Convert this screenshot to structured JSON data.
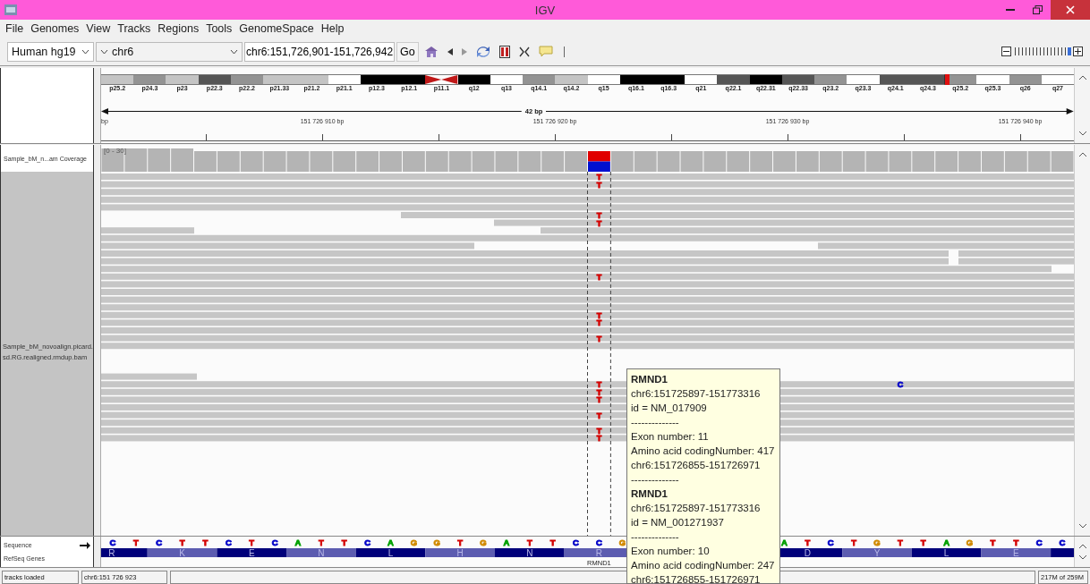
{
  "window": {
    "title": "IGV"
  },
  "menu": [
    "File",
    "Genomes",
    "View",
    "Tracks",
    "Regions",
    "Tools",
    "GenomeSpace",
    "Help"
  ],
  "toolbar": {
    "genome": "Human hg19",
    "chromosome": "chr6",
    "locus": "chr6:151,726,901-151,726,942",
    "go": "Go",
    "zoom": {
      "level": 1
    }
  },
  "ideogram": {
    "bands": [
      {
        "label": "p25.2",
        "kind": "gpos25",
        "current": false
      },
      {
        "label": "p24.3",
        "kind": "gpos50",
        "current": false
      },
      {
        "label": "p23",
        "kind": "gpos25",
        "current": false
      },
      {
        "label": "p22.3",
        "kind": "gpos75",
        "current": false
      },
      {
        "label": "p22.2",
        "kind": "gpos50",
        "current": false
      },
      {
        "label": "p21.33",
        "kind": "gpos25",
        "current": false
      },
      {
        "label": "p21.2",
        "kind": "gpos25",
        "current": false
      },
      {
        "label": "p21.1",
        "kind": "gneg",
        "current": false
      },
      {
        "label": "p12.3",
        "kind": "gpos100",
        "current": false
      },
      {
        "label": "p12.1",
        "kind": "gpos100",
        "current": false
      },
      {
        "label": "p11.1",
        "kind": "acen",
        "current": false
      },
      {
        "label": "q12",
        "kind": "gpos100",
        "current": false
      },
      {
        "label": "q13",
        "kind": "gneg",
        "current": false
      },
      {
        "label": "q14.1",
        "kind": "gpos50",
        "current": false
      },
      {
        "label": "q14.2",
        "kind": "gpos25",
        "current": false
      },
      {
        "label": "q15",
        "kind": "gneg",
        "current": false
      },
      {
        "label": "q16.1",
        "kind": "gpos100",
        "current": false
      },
      {
        "label": "q16.3",
        "kind": "gpos100",
        "current": false
      },
      {
        "label": "q21",
        "kind": "gneg",
        "current": false
      },
      {
        "label": "q22.1",
        "kind": "gpos75",
        "current": false
      },
      {
        "label": "q22.31",
        "kind": "gpos100",
        "current": false
      },
      {
        "label": "q22.33",
        "kind": "gpos75",
        "current": false
      },
      {
        "label": "q23.2",
        "kind": "gpos50",
        "current": false
      },
      {
        "label": "q23.3",
        "kind": "gneg",
        "current": false
      },
      {
        "label": "q24.1",
        "kind": "gpos75",
        "current": false
      },
      {
        "label": "q24.3",
        "kind": "gpos75",
        "current": false
      },
      {
        "label": "q25.2",
        "kind": "gpos50",
        "current": true
      },
      {
        "label": "q25.3",
        "kind": "gneg",
        "current": false
      },
      {
        "label": "q26",
        "kind": "gpos50",
        "current": false
      },
      {
        "label": "q27",
        "kind": "gneg",
        "current": false
      }
    ]
  },
  "ruler": {
    "span": "42 bp",
    "labels": [
      "bp",
      "151 726 910 bp",
      "151 726 920 bp",
      "151 726 930 bp",
      "151 726 940 bp"
    ]
  },
  "tracks": {
    "coverage_name": "Sample_bM_n...am Coverage",
    "coverage_range": "[0 - 30]",
    "alignment_name": "Sample_bM_novoalign.picard.sd.RG.realigned.rmdup.bam",
    "sequence_name": "Sequence",
    "genes_name": "RefSeq Genes"
  },
  "alignments": {
    "rows": [
      {
        "kind": "full",
        "mismatches": [
          {
            "base": "T",
            "color": "#d40000",
            "kind": "center"
          }
        ]
      },
      {
        "kind": "full",
        "mismatches": [
          {
            "base": "T",
            "color": "#d40000",
            "kind": "center"
          }
        ]
      },
      {
        "kind": "full"
      },
      {
        "kind": "full"
      },
      {
        "kind": "full"
      },
      {
        "kind": "partial",
        "mismatches": [
          {
            "base": "T",
            "color": "#d40000",
            "kind": "center"
          }
        ]
      },
      {
        "kind": "partial",
        "mismatches": [
          {
            "base": "T",
            "color": "#d40000",
            "kind": "center"
          }
        ]
      },
      {
        "kind": "partial"
      },
      {
        "kind": "full"
      },
      {
        "kind": "partial"
      },
      {
        "kind": "partial"
      },
      {
        "kind": "partial"
      },
      {
        "kind": "partial"
      },
      {
        "kind": "full",
        "mismatches": [
          {
            "base": "T",
            "color": "#d40000",
            "kind": "center"
          }
        ]
      },
      {
        "kind": "full"
      },
      {
        "kind": "full"
      },
      {
        "kind": "full"
      },
      {
        "kind": "full"
      },
      {
        "kind": "full",
        "mismatches": [
          {
            "base": "T",
            "color": "#d40000",
            "kind": "center"
          }
        ]
      },
      {
        "kind": "full",
        "mismatches": [
          {
            "base": "T",
            "color": "#d40000",
            "kind": "center"
          }
        ]
      },
      {
        "kind": "full"
      },
      {
        "kind": "full",
        "mismatches": [
          {
            "base": "T",
            "color": "#d40000",
            "kind": "center"
          }
        ]
      },
      {
        "kind": "full"
      },
      {
        "kind": "partial"
      },
      {
        "kind": "full",
        "mismatches": [
          {
            "base": "T",
            "color": "#d40000",
            "kind": "center"
          },
          {
            "base": "C",
            "color": "#0000c8",
            "kind": "right"
          }
        ]
      },
      {
        "kind": "full",
        "mismatches": [
          {
            "base": "T",
            "color": "#d40000",
            "kind": "center"
          }
        ]
      },
      {
        "kind": "full",
        "mismatches": [
          {
            "base": "T",
            "color": "#d40000",
            "kind": "center"
          }
        ]
      },
      {
        "kind": "full"
      },
      {
        "kind": "full",
        "mismatches": [
          {
            "base": "T",
            "color": "#d40000",
            "kind": "center"
          }
        ]
      },
      {
        "kind": "full"
      },
      {
        "kind": "full",
        "mismatches": [
          {
            "base": "T",
            "color": "#d40000",
            "kind": "center"
          }
        ]
      },
      {
        "kind": "full",
        "mismatches": [
          {
            "base": "T",
            "color": "#d40000",
            "kind": "center"
          }
        ]
      }
    ]
  },
  "sequence": {
    "left": [
      {
        "base": "C",
        "color": "#0000c8"
      },
      {
        "base": "T",
        "color": "#d40000"
      },
      {
        "base": "C",
        "color": "#0000c8"
      },
      {
        "base": "T",
        "color": "#d40000"
      },
      {
        "base": "T",
        "color": "#d40000"
      },
      {
        "base": "C",
        "color": "#0000c8"
      },
      {
        "base": "T",
        "color": "#d40000"
      },
      {
        "base": "C",
        "color": "#0000c8"
      },
      {
        "base": "A",
        "color": "#00a000"
      },
      {
        "base": "T",
        "color": "#d40000"
      },
      {
        "base": "T",
        "color": "#d40000"
      },
      {
        "base": "C",
        "color": "#0000c8"
      },
      {
        "base": "A",
        "color": "#00a000"
      },
      {
        "base": "G",
        "color": "#d18a00"
      },
      {
        "base": "G",
        "color": "#d18a00"
      },
      {
        "base": "T",
        "color": "#d40000"
      },
      {
        "base": "G",
        "color": "#d18a00"
      },
      {
        "base": "A",
        "color": "#00a000"
      },
      {
        "base": "T",
        "color": "#d40000"
      },
      {
        "base": "T",
        "color": "#d40000"
      },
      {
        "base": "C",
        "color": "#0000c8"
      },
      {
        "base": "C",
        "color": "#0000c8"
      },
      {
        "base": "G",
        "color": "#d18a00"
      }
    ],
    "right": [
      {
        "base": "A",
        "color": "#00a000"
      },
      {
        "base": "T",
        "color": "#d40000"
      },
      {
        "base": "C",
        "color": "#0000c8"
      },
      {
        "base": "T",
        "color": "#d40000"
      },
      {
        "base": "G",
        "color": "#d18a00"
      },
      {
        "base": "T",
        "color": "#d40000"
      },
      {
        "base": "T",
        "color": "#d40000"
      },
      {
        "base": "A",
        "color": "#00a000"
      },
      {
        "base": "G",
        "color": "#d18a00"
      },
      {
        "base": "T",
        "color": "#d40000"
      },
      {
        "base": "T",
        "color": "#d40000"
      },
      {
        "base": "C",
        "color": "#0000c8"
      },
      {
        "base": "C",
        "color": "#0000c8"
      }
    ]
  },
  "gene": {
    "name": "RMND1",
    "amino_acids_left": [
      "R",
      "K",
      "E",
      "N",
      "L",
      "H",
      "N",
      "R"
    ],
    "amino_acids_right": [
      "D",
      "Y",
      "L",
      "E"
    ]
  },
  "tooltip": {
    "entries": [
      {
        "name": "RMND1",
        "lines": [
          "chr6:151725897-151773316",
          "id = NM_017909",
          "--------------",
          "Exon number: 11",
          "Amino acid codingNumber: 417",
          "chr6:151726855-151726971",
          "--------------"
        ]
      },
      {
        "name": "RMND1",
        "lines": [
          "chr6:151725897-151773316",
          "id = NM_001271937",
          "--------------",
          "Exon number: 10",
          "Amino acid codingNumber: 247",
          "chr6:151726855-151726971"
        ]
      }
    ]
  },
  "status_bar": {
    "message": "tracks loaded",
    "position": "chr6:151 726 923",
    "memory": "217M of 259M"
  }
}
